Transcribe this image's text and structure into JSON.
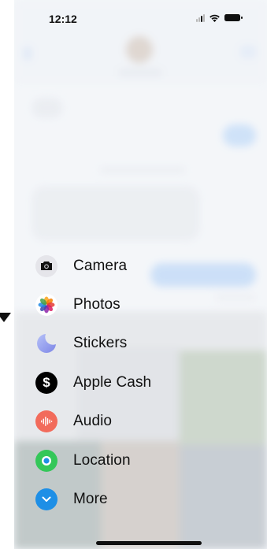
{
  "status_bar": {
    "time": "12:12",
    "icons": [
      "cellular-signal-icon",
      "wifi-icon",
      "battery-icon"
    ]
  },
  "attachment_menu": {
    "items": [
      {
        "label": "Camera",
        "icon": "camera-icon",
        "color": "#e5e5ea"
      },
      {
        "label": "Photos",
        "icon": "photos-icon",
        "color": "#ffffff"
      },
      {
        "label": "Stickers",
        "icon": "stickers-icon",
        "color": "#9aa4f5"
      },
      {
        "label": "Apple Cash",
        "icon": "apple-cash-icon",
        "color": "#000000"
      },
      {
        "label": "Audio",
        "icon": "audio-icon",
        "color": "#f26b5b"
      },
      {
        "label": "Location",
        "icon": "location-icon",
        "color": "#34c759"
      },
      {
        "label": "More",
        "icon": "chevron-down-icon",
        "color": "#1e8fe6"
      }
    ]
  }
}
